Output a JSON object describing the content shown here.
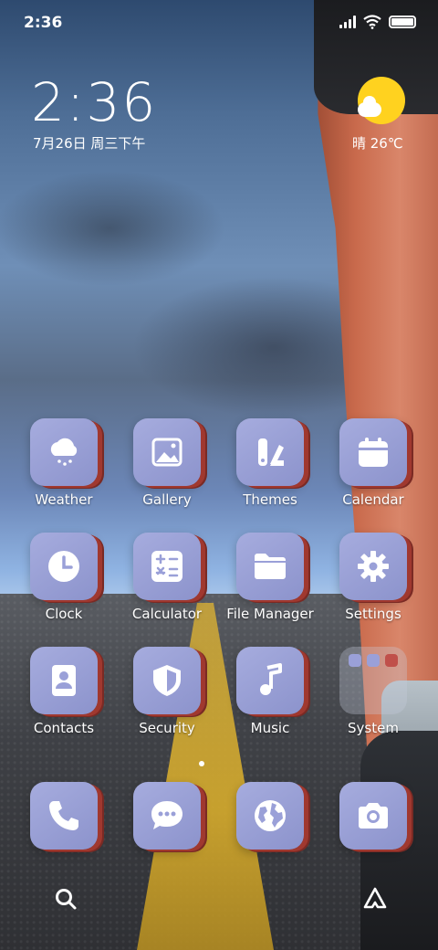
{
  "status_bar": {
    "time": "2:36"
  },
  "clock_widget": {
    "time": "2:36",
    "date": "7月26日 周三下午"
  },
  "weather_widget": {
    "text": "晴 26℃"
  },
  "apps": [
    {
      "label": "Weather",
      "icon": "weather-icon"
    },
    {
      "label": "Gallery",
      "icon": "gallery-icon"
    },
    {
      "label": "Themes",
      "icon": "themes-icon"
    },
    {
      "label": "Calendar",
      "icon": "calendar-icon"
    },
    {
      "label": "Clock",
      "icon": "clock-icon"
    },
    {
      "label": "Calculator",
      "icon": "calculator-icon"
    },
    {
      "label": "File Manager",
      "icon": "folder-icon"
    },
    {
      "label": "Settings",
      "icon": "gear-icon"
    },
    {
      "label": "Contacts",
      "icon": "contacts-icon"
    },
    {
      "label": "Security",
      "icon": "shield-icon"
    },
    {
      "label": "Music",
      "icon": "music-note-icon"
    },
    {
      "label": "System",
      "icon": "folder-icon"
    }
  ],
  "dock": [
    {
      "icon": "phone-icon"
    },
    {
      "icon": "message-icon"
    },
    {
      "icon": "globe-icon"
    },
    {
      "icon": "camera-icon"
    }
  ],
  "bottom_bar": [
    {
      "icon": "search-icon"
    },
    {
      "icon": "assistant-icon"
    }
  ],
  "colors": {
    "tile": "#9aa0d8",
    "tile_edge": "#a0382f",
    "sun": "#ffd21f"
  }
}
